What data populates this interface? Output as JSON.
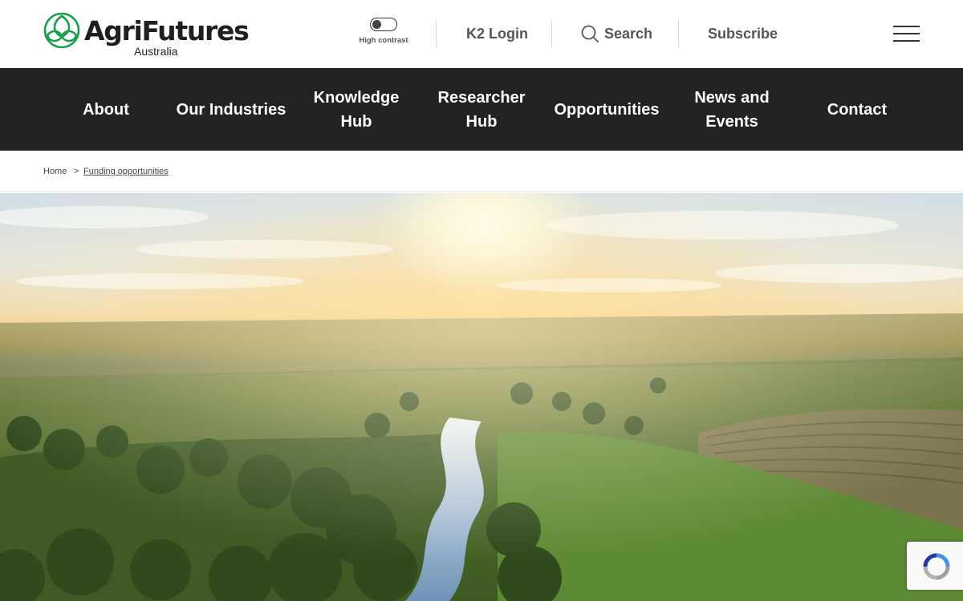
{
  "brand": {
    "name": "AgriFutures",
    "sub": "Australia",
    "color": "#1aa04a"
  },
  "utility": {
    "toggle_label": "High contrast",
    "login": "K2 Login",
    "search": "Search",
    "subscribe": "Subscribe"
  },
  "nav": [
    {
      "label": "About"
    },
    {
      "label": "Our Industries"
    },
    {
      "label": "Knowledge Hub"
    },
    {
      "label": "Researcher Hub"
    },
    {
      "label": "Opportunities"
    },
    {
      "label": "News and Events"
    },
    {
      "label": "Contact"
    }
  ],
  "breadcrumb": {
    "home": "Home",
    "separator": ">",
    "current": "Funding opportunities"
  },
  "colors": {
    "nav_bg": "#222222",
    "utility_text": "#555555"
  },
  "icons": {
    "logo": "agrifutures-leaf-logo",
    "search": "search-icon",
    "menu": "hamburger-menu-icon",
    "captcha": "recaptcha-icon"
  }
}
